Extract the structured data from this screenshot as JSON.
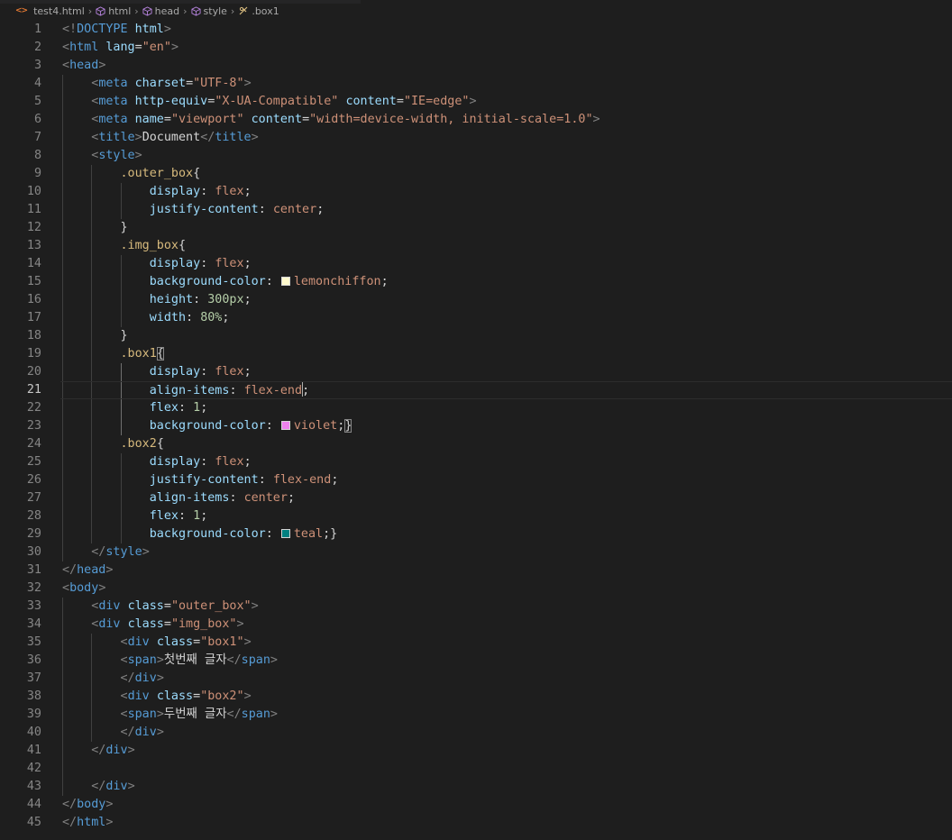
{
  "breadcrumb": {
    "file_icon": "<>",
    "items": [
      "test4.html",
      "html",
      "head",
      "style",
      ".box1"
    ]
  },
  "editor": {
    "active_line": 21,
    "colors": {
      "lemonchiffon": "#fffacd",
      "violet": "#ee82ee",
      "teal": "#008080"
    },
    "lines": [
      {
        "n": 1,
        "t": [
          [
            "br",
            "<!"
          ],
          [
            "tag",
            "DOCTYPE"
          ],
          [
            "txt",
            " "
          ],
          [
            "attr",
            "html"
          ],
          [
            "br",
            ">"
          ]
        ]
      },
      {
        "n": 2,
        "t": [
          [
            "br",
            "<"
          ],
          [
            "tag",
            "html"
          ],
          [
            "txt",
            " "
          ],
          [
            "attr",
            "lang"
          ],
          [
            "txt",
            "="
          ],
          [
            "str",
            "\"en\""
          ],
          [
            "br",
            ">"
          ]
        ]
      },
      {
        "n": 3,
        "t": [
          [
            "br",
            "<"
          ],
          [
            "tag",
            "head"
          ],
          [
            "br",
            ">"
          ]
        ]
      },
      {
        "n": 4,
        "t": [
          [
            "txt",
            "    "
          ],
          [
            "br",
            "<"
          ],
          [
            "tag",
            "meta"
          ],
          [
            "txt",
            " "
          ],
          [
            "attr",
            "charset"
          ],
          [
            "txt",
            "="
          ],
          [
            "str",
            "\"UTF-8\""
          ],
          [
            "br",
            ">"
          ]
        ]
      },
      {
        "n": 5,
        "t": [
          [
            "txt",
            "    "
          ],
          [
            "br",
            "<"
          ],
          [
            "tag",
            "meta"
          ],
          [
            "txt",
            " "
          ],
          [
            "attr",
            "http-equiv"
          ],
          [
            "txt",
            "="
          ],
          [
            "str",
            "\"X-UA-Compatible\""
          ],
          [
            "txt",
            " "
          ],
          [
            "attr",
            "content"
          ],
          [
            "txt",
            "="
          ],
          [
            "str",
            "\"IE=edge\""
          ],
          [
            "br",
            ">"
          ]
        ]
      },
      {
        "n": 6,
        "t": [
          [
            "txt",
            "    "
          ],
          [
            "br",
            "<"
          ],
          [
            "tag",
            "meta"
          ],
          [
            "txt",
            " "
          ],
          [
            "attr",
            "name"
          ],
          [
            "txt",
            "="
          ],
          [
            "str",
            "\"viewport\""
          ],
          [
            "txt",
            " "
          ],
          [
            "attr",
            "content"
          ],
          [
            "txt",
            "="
          ],
          [
            "str",
            "\"width=device-width, initial-scale=1.0\""
          ],
          [
            "br",
            ">"
          ]
        ]
      },
      {
        "n": 7,
        "t": [
          [
            "txt",
            "    "
          ],
          [
            "br",
            "<"
          ],
          [
            "tag",
            "title"
          ],
          [
            "br",
            ">"
          ],
          [
            "txt",
            "Document"
          ],
          [
            "br",
            "</"
          ],
          [
            "tag",
            "title"
          ],
          [
            "br",
            ">"
          ]
        ]
      },
      {
        "n": 8,
        "t": [
          [
            "txt",
            "    "
          ],
          [
            "br",
            "<"
          ],
          [
            "tag",
            "style"
          ],
          [
            "br",
            ">"
          ]
        ]
      },
      {
        "n": 9,
        "t": [
          [
            "txt",
            "        "
          ],
          [
            "sel",
            ".outer_box"
          ],
          [
            "punc",
            "{"
          ]
        ]
      },
      {
        "n": 10,
        "t": [
          [
            "txt",
            "            "
          ],
          [
            "prop",
            "display"
          ],
          [
            "punc",
            ": "
          ],
          [
            "val",
            "flex"
          ],
          [
            "punc",
            ";"
          ]
        ]
      },
      {
        "n": 11,
        "t": [
          [
            "txt",
            "            "
          ],
          [
            "prop",
            "justify-content"
          ],
          [
            "punc",
            ": "
          ],
          [
            "val",
            "center"
          ],
          [
            "punc",
            ";"
          ]
        ]
      },
      {
        "n": 12,
        "t": [
          [
            "txt",
            "        "
          ],
          [
            "punc",
            "}"
          ]
        ]
      },
      {
        "n": 13,
        "t": [
          [
            "txt",
            "        "
          ],
          [
            "sel",
            ".img_box"
          ],
          [
            "punc",
            "{"
          ]
        ]
      },
      {
        "n": 14,
        "t": [
          [
            "txt",
            "            "
          ],
          [
            "prop",
            "display"
          ],
          [
            "punc",
            ": "
          ],
          [
            "val",
            "flex"
          ],
          [
            "punc",
            ";"
          ]
        ]
      },
      {
        "n": 15,
        "t": [
          [
            "txt",
            "            "
          ],
          [
            "prop",
            "background-color"
          ],
          [
            "punc",
            ": "
          ],
          [
            "swatch",
            "lemonchiffon"
          ],
          [
            "val",
            "lemonchiffon"
          ],
          [
            "punc",
            ";"
          ]
        ]
      },
      {
        "n": 16,
        "t": [
          [
            "txt",
            "            "
          ],
          [
            "prop",
            "height"
          ],
          [
            "punc",
            ": "
          ],
          [
            "num",
            "300px"
          ],
          [
            "punc",
            ";"
          ]
        ]
      },
      {
        "n": 17,
        "t": [
          [
            "txt",
            "            "
          ],
          [
            "prop",
            "width"
          ],
          [
            "punc",
            ": "
          ],
          [
            "num",
            "80%"
          ],
          [
            "punc",
            ";"
          ]
        ]
      },
      {
        "n": 18,
        "t": [
          [
            "txt",
            "        "
          ],
          [
            "punc",
            "}"
          ]
        ]
      },
      {
        "n": 19,
        "t": [
          [
            "txt",
            "        "
          ],
          [
            "sel",
            ".box1"
          ],
          [
            "bm",
            "{"
          ]
        ]
      },
      {
        "n": 20,
        "t": [
          [
            "txt",
            "            "
          ],
          [
            "prop",
            "display"
          ],
          [
            "punc",
            ": "
          ],
          [
            "val",
            "flex"
          ],
          [
            "punc",
            ";"
          ]
        ]
      },
      {
        "n": 21,
        "t": [
          [
            "txt",
            "            "
          ],
          [
            "prop",
            "align-items"
          ],
          [
            "punc",
            ": "
          ],
          [
            "val",
            "flex-end"
          ],
          [
            "cursor",
            ""
          ],
          [
            "punc",
            ";"
          ]
        ]
      },
      {
        "n": 22,
        "t": [
          [
            "txt",
            "            "
          ],
          [
            "prop",
            "flex"
          ],
          [
            "punc",
            ": "
          ],
          [
            "num",
            "1"
          ],
          [
            "punc",
            ";"
          ]
        ]
      },
      {
        "n": 23,
        "t": [
          [
            "txt",
            "            "
          ],
          [
            "prop",
            "background-color"
          ],
          [
            "punc",
            ": "
          ],
          [
            "swatch",
            "violet"
          ],
          [
            "val",
            "violet"
          ],
          [
            "punc",
            ";"
          ],
          [
            "bm",
            "}"
          ]
        ]
      },
      {
        "n": 24,
        "t": [
          [
            "txt",
            "        "
          ],
          [
            "sel",
            ".box2"
          ],
          [
            "punc",
            "{"
          ]
        ]
      },
      {
        "n": 25,
        "t": [
          [
            "txt",
            "            "
          ],
          [
            "prop",
            "display"
          ],
          [
            "punc",
            ": "
          ],
          [
            "val",
            "flex"
          ],
          [
            "punc",
            ";"
          ]
        ]
      },
      {
        "n": 26,
        "t": [
          [
            "txt",
            "            "
          ],
          [
            "prop",
            "justify-content"
          ],
          [
            "punc",
            ": "
          ],
          [
            "val",
            "flex-end"
          ],
          [
            "punc",
            ";"
          ]
        ]
      },
      {
        "n": 27,
        "t": [
          [
            "txt",
            "            "
          ],
          [
            "prop",
            "align-items"
          ],
          [
            "punc",
            ": "
          ],
          [
            "val",
            "center"
          ],
          [
            "punc",
            ";"
          ]
        ]
      },
      {
        "n": 28,
        "t": [
          [
            "txt",
            "            "
          ],
          [
            "prop",
            "flex"
          ],
          [
            "punc",
            ": "
          ],
          [
            "num",
            "1"
          ],
          [
            "punc",
            ";"
          ]
        ]
      },
      {
        "n": 29,
        "t": [
          [
            "txt",
            "            "
          ],
          [
            "prop",
            "background-color"
          ],
          [
            "punc",
            ": "
          ],
          [
            "swatch",
            "teal"
          ],
          [
            "val",
            "teal"
          ],
          [
            "punc",
            ";}"
          ]
        ]
      },
      {
        "n": 30,
        "t": [
          [
            "txt",
            "    "
          ],
          [
            "br",
            "</"
          ],
          [
            "tag",
            "style"
          ],
          [
            "br",
            ">"
          ]
        ]
      },
      {
        "n": 31,
        "t": [
          [
            "br",
            "</"
          ],
          [
            "tag",
            "head"
          ],
          [
            "br",
            ">"
          ]
        ]
      },
      {
        "n": 32,
        "t": [
          [
            "br",
            "<"
          ],
          [
            "tag",
            "body"
          ],
          [
            "br",
            ">"
          ]
        ]
      },
      {
        "n": 33,
        "t": [
          [
            "txt",
            "    "
          ],
          [
            "br",
            "<"
          ],
          [
            "tag",
            "div"
          ],
          [
            "txt",
            " "
          ],
          [
            "attr",
            "class"
          ],
          [
            "txt",
            "="
          ],
          [
            "str",
            "\"outer_box\""
          ],
          [
            "br",
            ">"
          ]
        ]
      },
      {
        "n": 34,
        "t": [
          [
            "txt",
            "    "
          ],
          [
            "br",
            "<"
          ],
          [
            "tag",
            "div"
          ],
          [
            "txt",
            " "
          ],
          [
            "attr",
            "class"
          ],
          [
            "txt",
            "="
          ],
          [
            "str",
            "\"img_box\""
          ],
          [
            "br",
            ">"
          ]
        ]
      },
      {
        "n": 35,
        "t": [
          [
            "txt",
            "        "
          ],
          [
            "br",
            "<"
          ],
          [
            "tag",
            "div"
          ],
          [
            "txt",
            " "
          ],
          [
            "attr",
            "class"
          ],
          [
            "txt",
            "="
          ],
          [
            "str",
            "\"box1\""
          ],
          [
            "br",
            ">"
          ]
        ]
      },
      {
        "n": 36,
        "t": [
          [
            "txt",
            "        "
          ],
          [
            "br",
            "<"
          ],
          [
            "tag",
            "span"
          ],
          [
            "br",
            ">"
          ],
          [
            "txt",
            "첫번째 글자"
          ],
          [
            "br",
            "</"
          ],
          [
            "tag",
            "span"
          ],
          [
            "br",
            ">"
          ]
        ]
      },
      {
        "n": 37,
        "t": [
          [
            "txt",
            "        "
          ],
          [
            "br",
            "</"
          ],
          [
            "tag",
            "div"
          ],
          [
            "br",
            ">"
          ]
        ]
      },
      {
        "n": 38,
        "t": [
          [
            "txt",
            "        "
          ],
          [
            "br",
            "<"
          ],
          [
            "tag",
            "div"
          ],
          [
            "txt",
            " "
          ],
          [
            "attr",
            "class"
          ],
          [
            "txt",
            "="
          ],
          [
            "str",
            "\"box2\""
          ],
          [
            "br",
            ">"
          ]
        ]
      },
      {
        "n": 39,
        "t": [
          [
            "txt",
            "        "
          ],
          [
            "br",
            "<"
          ],
          [
            "tag",
            "span"
          ],
          [
            "br",
            ">"
          ],
          [
            "txt",
            "두번째 글자"
          ],
          [
            "br",
            "</"
          ],
          [
            "tag",
            "span"
          ],
          [
            "br",
            ">"
          ]
        ]
      },
      {
        "n": 40,
        "t": [
          [
            "txt",
            "        "
          ],
          [
            "br",
            "</"
          ],
          [
            "tag",
            "div"
          ],
          [
            "br",
            ">"
          ]
        ]
      },
      {
        "n": 41,
        "t": [
          [
            "txt",
            "    "
          ],
          [
            "br",
            "</"
          ],
          [
            "tag",
            "div"
          ],
          [
            "br",
            ">"
          ]
        ]
      },
      {
        "n": 42,
        "t": []
      },
      {
        "n": 43,
        "t": [
          [
            "txt",
            "    "
          ],
          [
            "br",
            "</"
          ],
          [
            "tag",
            "div"
          ],
          [
            "br",
            ">"
          ]
        ]
      },
      {
        "n": 44,
        "t": [
          [
            "br",
            "</"
          ],
          [
            "tag",
            "body"
          ],
          [
            "br",
            ">"
          ]
        ]
      },
      {
        "n": 45,
        "t": [
          [
            "br",
            "</"
          ],
          [
            "tag",
            "html"
          ],
          [
            "br",
            ">"
          ]
        ]
      }
    ]
  }
}
